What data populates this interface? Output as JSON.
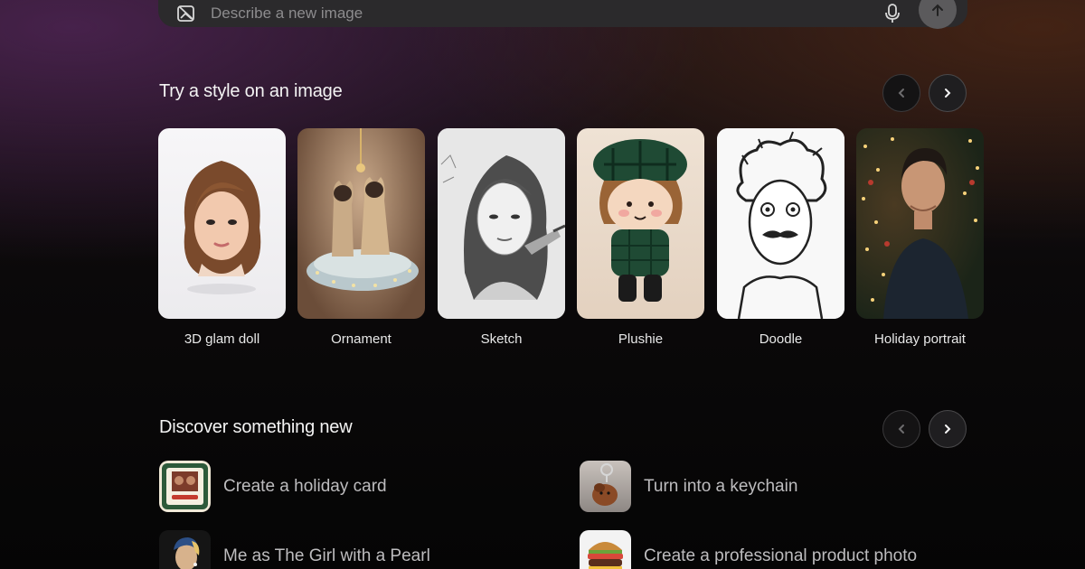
{
  "prompt": {
    "placeholder": "Describe a new image",
    "icons": [
      "image-edit-icon",
      "microphone-icon",
      "arrow-up-icon"
    ]
  },
  "style_section": {
    "title": "Try a style on an image",
    "nav": [
      "chevron-left-icon",
      "chevron-right-icon"
    ],
    "styles": [
      {
        "label": "3D glam doll"
      },
      {
        "label": "Ornament"
      },
      {
        "label": "Sketch"
      },
      {
        "label": "Plushie"
      },
      {
        "label": "Doodle"
      },
      {
        "label": "Holiday portrait"
      }
    ]
  },
  "discover_section": {
    "title": "Discover something new",
    "items": [
      {
        "label": "Create a holiday card"
      },
      {
        "label": "Turn into a keychain"
      },
      {
        "label": "Me as The Girl with a Pearl"
      },
      {
        "label": "Create a professional product photo"
      }
    ]
  },
  "colors": {
    "background": "#050505",
    "prompt_bar": "#2b2a2c",
    "text_primary": "#f4f4f4",
    "text_secondary": "#bdbcbe"
  }
}
